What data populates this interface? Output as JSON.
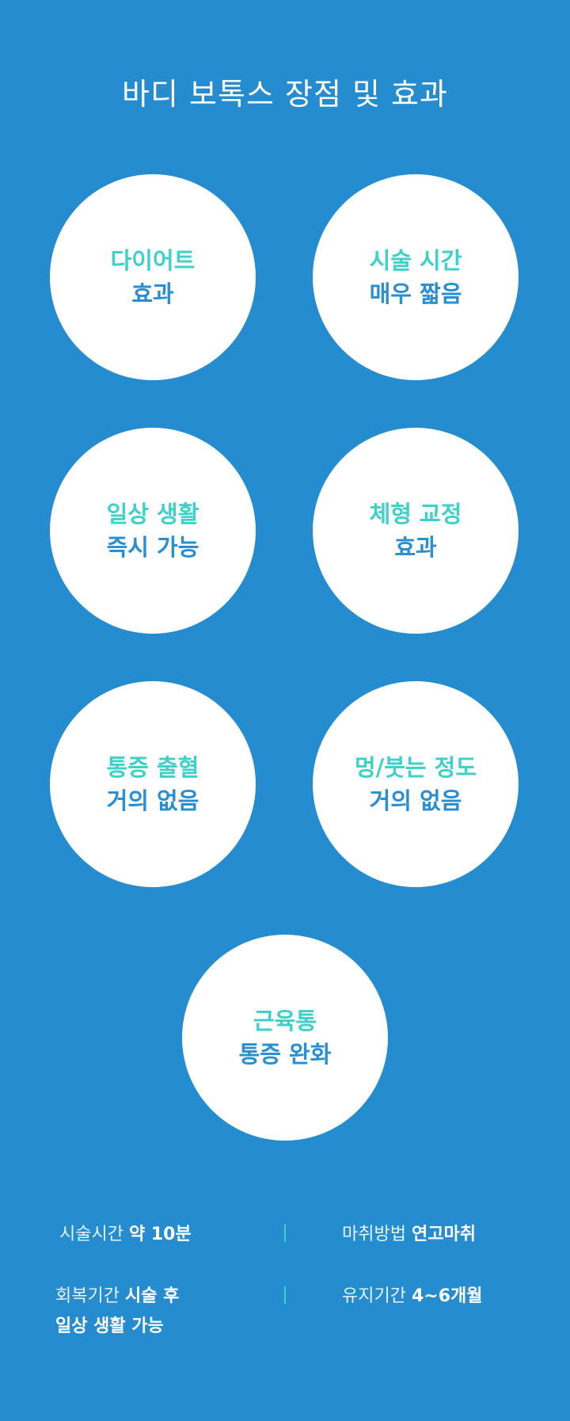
{
  "title": "바디 보톡스 장점 및 효과",
  "benefits": [
    {
      "line1": "다이어트",
      "line2": "효과"
    },
    {
      "line1": "시술 시간",
      "line2": "매우 짧음"
    },
    {
      "line1": "일상 생활",
      "line2": "즉시 가능"
    },
    {
      "line1": "체형 교정",
      "line2": "효과"
    },
    {
      "line1": "통증 출혈",
      "line2": "거의 없음"
    },
    {
      "line1": "멍/붓는 정도",
      "line2": "거의 없음"
    },
    {
      "line1": "근육통",
      "line2": "통증 완화"
    }
  ],
  "info": {
    "procedure_time": {
      "label": "시술시간",
      "value": "약 10분"
    },
    "anesthesia": {
      "label": "마취방법",
      "value": "연고마취"
    },
    "recovery": {
      "label": "회복기간",
      "value_line1": "시술 후",
      "value_line2": "일상 생활 가능"
    },
    "duration": {
      "label": "유지기간",
      "value": "4~6개월"
    }
  },
  "colors": {
    "background": "#248ccf",
    "accent_teal": "#3dd1c8",
    "accent_blue": "#2a8fd0",
    "circle": "#ffffff"
  }
}
